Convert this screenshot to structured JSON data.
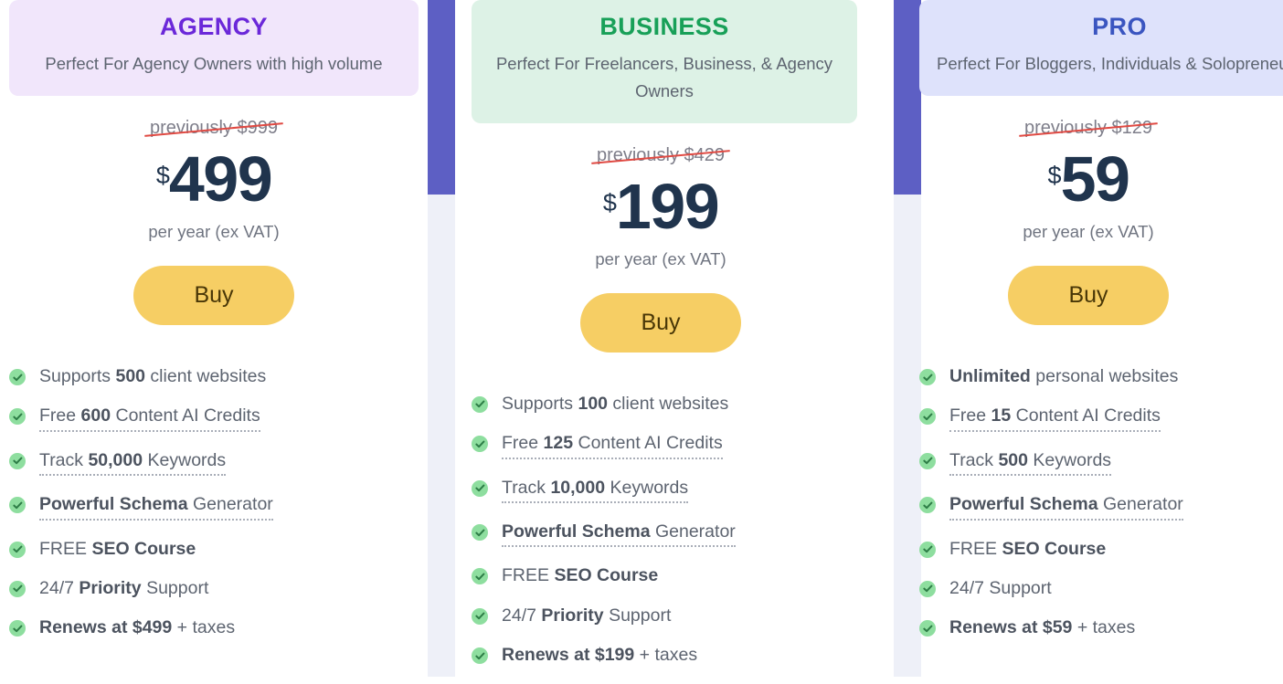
{
  "colors": {
    "rail_accent": "#5d5fc4",
    "rail_body": "#eef0f8",
    "buy_button_bg": "#f6ce64",
    "buy_button_text": "#493707",
    "check_circle": "#8ede9f",
    "check_mark": "#2d7d46",
    "strike_line": "#e04a43",
    "price_text": "#20344d"
  },
  "plans": [
    {
      "id": "agency",
      "title": "AGENCY",
      "title_color": "#6b28d9",
      "header_bg": "#f1e6fb",
      "tagline": "Perfect For Agency Owners with high volume",
      "previous_price": "previously $999",
      "currency": "$",
      "amount": "499",
      "period": "per year (ex VAT)",
      "buy_label": "Buy",
      "features": [
        {
          "prefix": "Supports ",
          "strong": "500",
          "suffix": " client websites",
          "tooltip": false
        },
        {
          "prefix": "Free ",
          "strong": "600",
          "suffix": " Content AI Credits",
          "tooltip": true
        },
        {
          "prefix": "Track ",
          "strong": "50,000",
          "suffix": " Keywords",
          "tooltip": true
        },
        {
          "prefix": "",
          "strong": "Powerful Schema",
          "suffix": " Generator",
          "tooltip": true
        },
        {
          "prefix": "FREE ",
          "strong": "SEO Course",
          "suffix": "",
          "tooltip": false
        },
        {
          "prefix": "24/7 ",
          "strong": "Priority",
          "suffix": " Support",
          "tooltip": false
        },
        {
          "prefix": "",
          "strong": "Renews at $499",
          "suffix": " + taxes",
          "tooltip": false
        }
      ]
    },
    {
      "id": "business",
      "title": "BUSINESS",
      "title_color": "#18a058",
      "header_bg": "#ddf2e6",
      "tagline": "Perfect For Freelancers, Business, & Agency Owners",
      "previous_price": "previously $429",
      "currency": "$",
      "amount": "199",
      "period": "per year (ex VAT)",
      "buy_label": "Buy",
      "features": [
        {
          "prefix": "Supports ",
          "strong": "100",
          "suffix": " client websites",
          "tooltip": false
        },
        {
          "prefix": "Free ",
          "strong": "125",
          "suffix": " Content AI Credits",
          "tooltip": true
        },
        {
          "prefix": "Track ",
          "strong": "10,000",
          "suffix": " Keywords",
          "tooltip": true
        },
        {
          "prefix": "",
          "strong": "Powerful Schema",
          "suffix": " Generator",
          "tooltip": true
        },
        {
          "prefix": "FREE ",
          "strong": "SEO Course",
          "suffix": "",
          "tooltip": false
        },
        {
          "prefix": "24/7 ",
          "strong": "Priority",
          "suffix": " Support",
          "tooltip": false
        },
        {
          "prefix": "",
          "strong": "Renews at $199",
          "suffix": " + taxes",
          "tooltip": false
        }
      ]
    },
    {
      "id": "pro",
      "title": "PRO",
      "title_color": "#3a55c0",
      "header_bg": "#dee2fb",
      "tagline": "Perfect For Bloggers, Individuals & Solopreneurs",
      "previous_price": "previously $129",
      "currency": "$",
      "amount": "59",
      "period": "per year (ex VAT)",
      "buy_label": "Buy",
      "features": [
        {
          "prefix": "",
          "strong": "Unlimited",
          "suffix": " personal websites",
          "tooltip": false
        },
        {
          "prefix": "Free ",
          "strong": "15",
          "suffix": " Content AI Credits",
          "tooltip": true
        },
        {
          "prefix": "Track ",
          "strong": "500",
          "suffix": " Keywords",
          "tooltip": true
        },
        {
          "prefix": "",
          "strong": "Powerful Schema",
          "suffix": " Generator",
          "tooltip": true
        },
        {
          "prefix": "FREE ",
          "strong": "SEO Course",
          "suffix": "",
          "tooltip": false
        },
        {
          "prefix": "24/7 Support",
          "strong": "",
          "suffix": "",
          "tooltip": false
        },
        {
          "prefix": "",
          "strong": "Renews at $59",
          "suffix": " + taxes",
          "tooltip": false
        }
      ]
    }
  ]
}
